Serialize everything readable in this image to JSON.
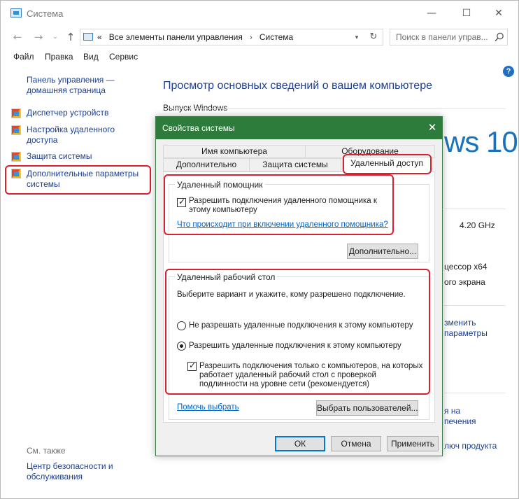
{
  "window": {
    "title": "Система",
    "minimize": "—",
    "maximize": "☐",
    "close": "✕"
  },
  "nav": {
    "back": "←",
    "forward": "→",
    "dropdown": "⌄",
    "up": "↑"
  },
  "address": {
    "chevron": "«",
    "crumb1": "Все элементы панели управления",
    "sep": "›",
    "crumb2": "Система",
    "dropdown": "▾",
    "refresh": "↻"
  },
  "search": {
    "placeholder": "Поиск в панели управ..."
  },
  "menu": [
    "Файл",
    "Правка",
    "Вид",
    "Сервис"
  ],
  "sidebar": {
    "home": "Панель управления — домашняя страница",
    "items": [
      "Диспетчер устройств",
      "Настройка удаленного доступа",
      "Защита системы",
      "Дополнительные параметры системы"
    ],
    "see_also": "См. также",
    "security": "Центр безопасности и обслуживания"
  },
  "help": "?",
  "main": {
    "title": "Просмотр основных сведений о вашем компьютере",
    "edition_label": "Выпуск Windows",
    "win10": "ws 10",
    "cpu_speed": "4.20 GHz",
    "cpu_arch": "цессор x64",
    "screen": "ого экрана",
    "change_link1": "зменить",
    "change_link2": "параметры",
    "activation1": "я на",
    "activation2": "печения",
    "product_key": "люч продукта"
  },
  "dialog": {
    "title": "Свойства системы",
    "close": "✕",
    "tabs": {
      "computer_name": "Имя компьютера",
      "hardware": "Оборудование",
      "advanced": "Дополнительно",
      "protection": "Защита системы",
      "remote": "Удаленный доступ"
    },
    "assistance": {
      "group_title": "Удаленный помощник",
      "checkbox_label": "Разрешить подключения удаленного помощника к этому компьютеру",
      "link": "Что происходит при включении удаленного помощника?",
      "advanced_button": "Дополнительно..."
    },
    "desktop": {
      "group_title": "Удаленный рабочий стол",
      "instruction": "Выберите вариант и укажите, кому разрешено подключение.",
      "radio_deny": "Не разрешать удаленные подключения к этому компьютеру",
      "radio_allow": "Разрешить удаленные подключения к этому компьютеру",
      "nla_checkbox": "Разрешить подключения только с компьютеров, на которых работает удаленный рабочий стол с проверкой подлинности на уровне сети (рекомендуется)",
      "help_link": "Помочь выбрать",
      "select_users_button": "Выбрать пользователей..."
    },
    "buttons": {
      "ok": "ОК",
      "cancel": "Отмена",
      "apply": "Применить"
    }
  },
  "colors": {
    "dialog_title_bg": "#2e7c3c",
    "highlight": "#d9202e",
    "link": "#1c3f8f",
    "accent": "#1a72bd"
  }
}
